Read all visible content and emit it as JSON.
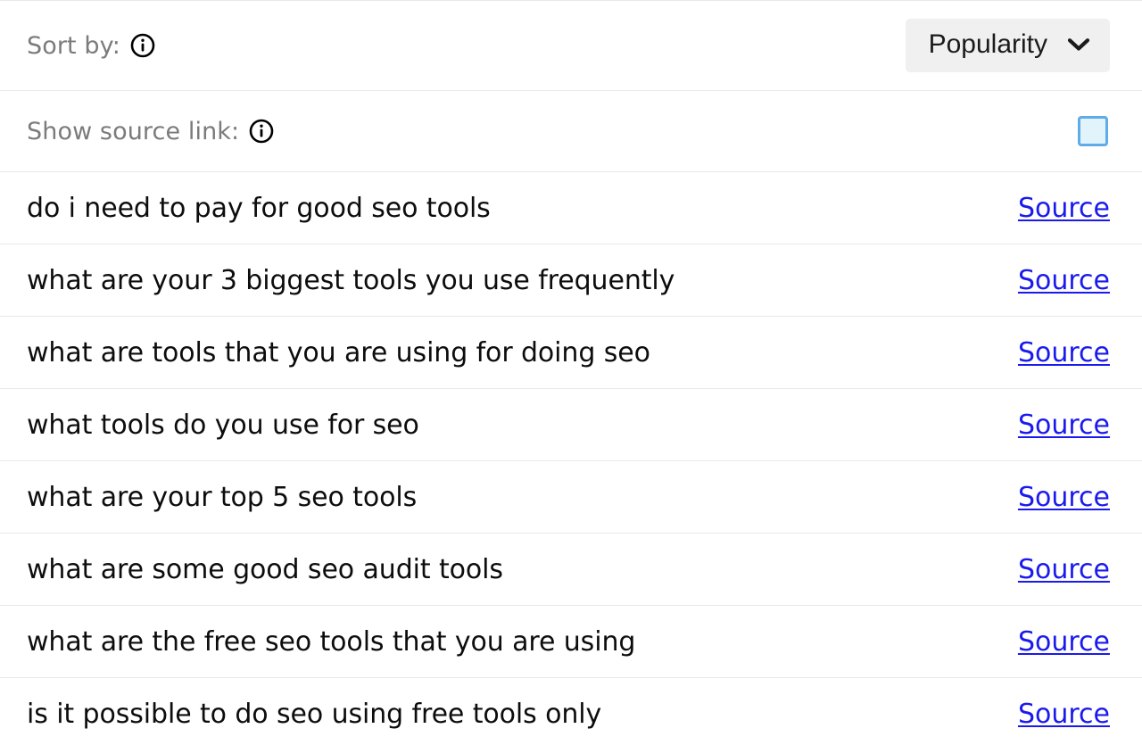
{
  "controls": {
    "sort": {
      "label": "Sort by:",
      "info_icon": "info-circle-icon",
      "selected": "Popularity",
      "chevron_icon": "chevron-down-icon"
    },
    "show_source_link": {
      "label": "Show source link:",
      "info_icon": "info-circle-icon",
      "checked": false,
      "checkbox_icon": "checkbox-unchecked-icon"
    }
  },
  "list": {
    "source_label": "Source",
    "rows": [
      {
        "query": "do i need to pay for good seo tools",
        "source": "Source"
      },
      {
        "query": "what are your 3 biggest tools you use frequently",
        "source": "Source"
      },
      {
        "query": "what are tools that you are using for doing seo",
        "source": "Source"
      },
      {
        "query": "what tools do you use for seo",
        "source": "Source"
      },
      {
        "query": "what are your top 5 seo tools",
        "source": "Source"
      },
      {
        "query": "what are some good seo audit tools",
        "source": "Source"
      },
      {
        "query": "what are the free seo tools that you are using",
        "source": "Source"
      },
      {
        "query": "is it possible to do seo using free tools only",
        "source": "Source"
      }
    ]
  },
  "colors": {
    "link": "#1a1aee",
    "label_text": "#7b7b7b",
    "row_text": "#0d0d0d",
    "divider": "#e9e9e9",
    "dropdown_bg": "#f0f0f0",
    "checkbox_border": "#61abe6",
    "checkbox_fill": "#e1f3fb"
  }
}
